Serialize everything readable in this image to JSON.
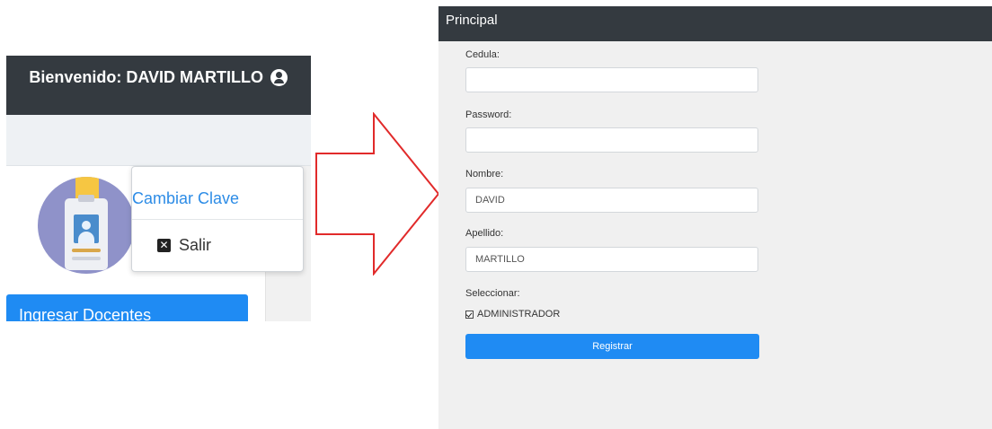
{
  "left_screen": {
    "navbar": {
      "welcome_text": "Bienvenido: DAVID MARTILLO",
      "user_icon": "user-circle-icon"
    },
    "dropdown": {
      "items": [
        {
          "label": "Cambiar Clave"
        },
        {
          "label": "Salir",
          "icon": "close-square-icon"
        }
      ]
    },
    "avatar_icon": "id-badge-icon",
    "sidebar": {
      "button_label": "Ingresar Docentes"
    },
    "colors": {
      "navbar": "#343a40",
      "accent": "#1f8bf3",
      "link": "#2d8ce6"
    }
  },
  "arrow": {
    "icon": "right-arrow-outline-icon",
    "color": "#e12a2a"
  },
  "right_screen": {
    "header": {
      "title": "Principal"
    },
    "form": {
      "cedula_label": "Cedula:",
      "cedula_value": "",
      "password_label": "Password:",
      "password_value": "",
      "nombre_label": "Nombre:",
      "nombre_value": "DAVID",
      "apellido_label": "Apellido:",
      "apellido_value": "MARTILLO",
      "select_label": "Seleccionar:",
      "role_option": "ADMINISTRADOR",
      "role_checked": true,
      "submit_label": "Registrar"
    },
    "colors": {
      "header": "#343a40",
      "button": "#1f8bf3",
      "background": "#f0f0f0"
    }
  }
}
